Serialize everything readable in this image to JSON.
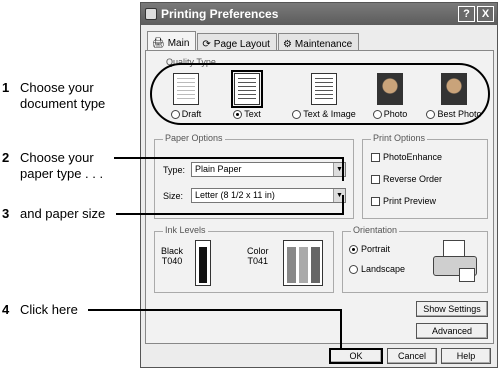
{
  "callouts": [
    {
      "num": "1",
      "lines": [
        "Choose your",
        "document type"
      ]
    },
    {
      "num": "2",
      "lines": [
        "Choose your",
        "paper type . . ."
      ]
    },
    {
      "num": "3",
      "lines": [
        "and paper size"
      ]
    },
    {
      "num": "4",
      "lines": [
        "Click here"
      ]
    }
  ],
  "window": {
    "title": "Printing Preferences",
    "help_button": "?",
    "close_button": "X",
    "tabs": [
      "Main",
      "Page Layout",
      "Maintenance"
    ],
    "quality_type": {
      "label": "Quality Type",
      "options": [
        {
          "label": "Draft",
          "selected": false
        },
        {
          "label": "Text",
          "selected": true
        },
        {
          "label": "Text & Image",
          "selected": false
        },
        {
          "label": "Photo",
          "selected": false
        },
        {
          "label": "Best Photo",
          "selected": false
        }
      ]
    },
    "paper_options": {
      "label": "Paper Options",
      "type_label": "Type:",
      "type_value": "Plain Paper",
      "size_label": "Size:",
      "size_value": "Letter (8 1/2 x 11 in)"
    },
    "print_options": {
      "label": "Print Options",
      "items": [
        "PhotoEnhance",
        "Reverse Order",
        "Print Preview"
      ]
    },
    "ink_levels": {
      "label": "Ink Levels",
      "black_label": "Black",
      "black_code": "T040",
      "color_label": "Color",
      "color_code": "T041"
    },
    "orientation": {
      "label": "Orientation",
      "options": [
        {
          "label": "Portrait",
          "selected": true
        },
        {
          "label": "Landscape",
          "selected": false
        }
      ]
    },
    "buttons": {
      "show_settings": "Show Settings",
      "advanced": "Advanced",
      "ok": "OK",
      "cancel": "Cancel",
      "help": "Help"
    }
  }
}
